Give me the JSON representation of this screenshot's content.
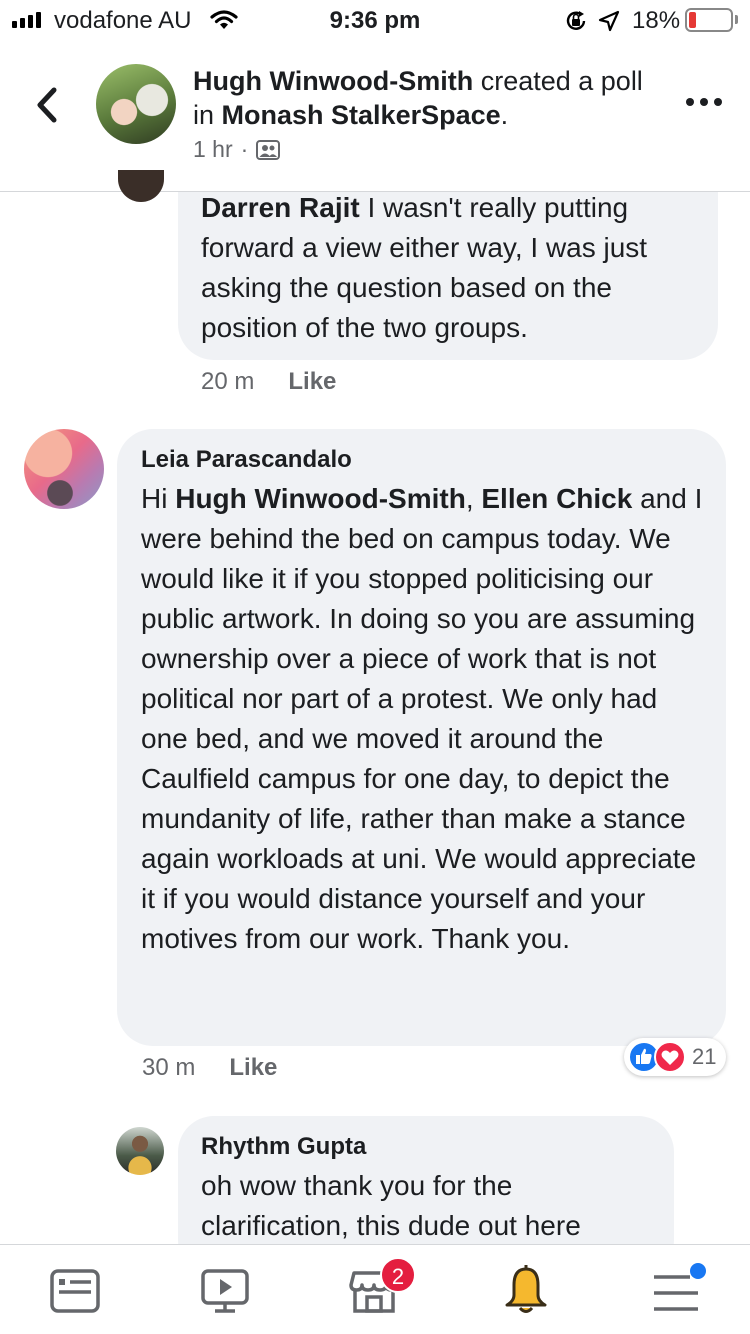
{
  "status_bar": {
    "carrier": "vodafone AU",
    "time": "9:36 pm",
    "battery_percent": "18%",
    "battery_level": 0.18,
    "icons": [
      "signal-icon",
      "wifi-icon",
      "orientation-lock-icon",
      "location-icon",
      "battery-icon"
    ]
  },
  "header": {
    "author": "Hugh Winwood-Smith",
    "action": " created a poll in ",
    "group": "Monash StalkerSpace",
    "suffix": ".",
    "time": "1 hr",
    "separator": "·",
    "icons": [
      "back-icon",
      "group-privacy-icon",
      "more-icon"
    ]
  },
  "comments": [
    {
      "author": "Darren Rajit",
      "text": " I wasn't really putting forward a view either way, I was just asking the question based on the position of the two groups.",
      "time": "20 m",
      "like_label": "Like"
    },
    {
      "author": "Leia Parascandalo",
      "text_prefix": "Hi ",
      "mention_1": "Hugh Winwood-Smith",
      "separator": ", ",
      "mention_2": "Ellen Chick",
      "text": " and I were behind the bed on campus today. We would like it if you stopped politicising our public artwork. In doing so you are assuming ownership over a piece of work that is not political nor part of a protest. We only had one bed, and we moved it around the Caulfield campus for one day, to depict the mundanity of life, rather than make a stance again workloads at uni. We would appreciate it if you would distance yourself and your motives from our work. Thank you.",
      "time": "30 m",
      "like_label": "Like",
      "reactions": [
        "like-reaction-icon",
        "love-reaction-icon"
      ],
      "reaction_count": "21"
    },
    {
      "author": "Rhythm Gupta",
      "text": "oh wow thank you for the clarification, this dude out here"
    }
  ],
  "bottom_nav": {
    "items": [
      "news-feed-icon",
      "watch-icon",
      "marketplace-icon",
      "notifications-icon",
      "menu-icon"
    ],
    "marketplace_badge": "2"
  },
  "colors": {
    "accent": "#1877f2",
    "bubble": "#f0f2f5",
    "badge": "#e41e3f",
    "notification_bell": "#f5b82e"
  }
}
